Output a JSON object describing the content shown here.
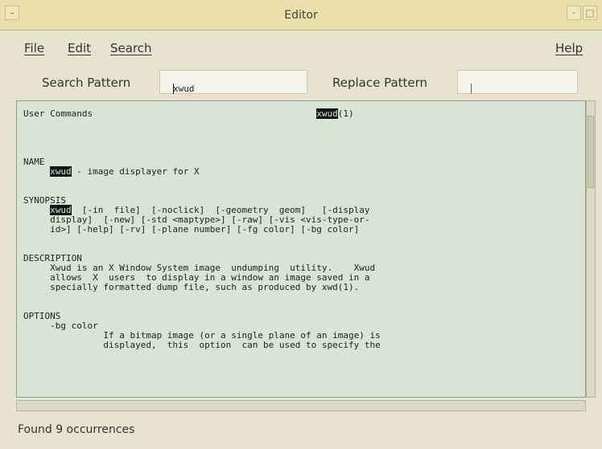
{
  "window": {
    "title": "Editor"
  },
  "menubar": {
    "file": {
      "u": "F",
      "rest": "ile"
    },
    "edit": {
      "u": "E",
      "rest": "dit"
    },
    "search": {
      "u": "S",
      "rest": "earch"
    },
    "help": {
      "u": "H",
      "rest": "elp"
    }
  },
  "search": {
    "label": "Search Pattern",
    "value": "xwud",
    "replace_label": "Replace Pattern",
    "replace_value": ""
  },
  "document": {
    "lines": [
      {
        "pre": "User Commands                                          ",
        "hl": "xwud",
        "post": "(1)"
      },
      {
        "pre": ""
      },
      {
        "pre": ""
      },
      {
        "pre": ""
      },
      {
        "pre": ""
      },
      {
        "pre": "NAME"
      },
      {
        "pre": "     ",
        "hl": "xwud",
        "post": " - image displayer for X"
      },
      {
        "pre": ""
      },
      {
        "pre": ""
      },
      {
        "pre": "SYNOPSIS"
      },
      {
        "pre": "     ",
        "hl": "xwud",
        "post": "  [-in  file]  [-noclick]  [-geometry  geom]   [-display"
      },
      {
        "pre": "     display]  [-new] [-std <maptype>] [-raw] [-vis <vis-type-or-"
      },
      {
        "pre": "     id>] [-help] [-rv] [-plane number] [-fg color] [-bg color]"
      },
      {
        "pre": ""
      },
      {
        "pre": ""
      },
      {
        "pre": "DESCRIPTION"
      },
      {
        "pre": "     Xwud is an X Window System image  undumping  utility.    Xwud"
      },
      {
        "pre": "     allows  X  users  to display in a window an image saved in a"
      },
      {
        "pre": "     specially formatted dump file, such as produced by xwd(1)."
      },
      {
        "pre": ""
      },
      {
        "pre": ""
      },
      {
        "pre": "OPTIONS"
      },
      {
        "pre": "     -bg color"
      },
      {
        "pre": "               If a bitmap image (or a single plane of an image) is"
      },
      {
        "pre": "               displayed,  this  option  can be used to specify the"
      }
    ]
  },
  "status": {
    "text": "Found 9 occurrences"
  }
}
